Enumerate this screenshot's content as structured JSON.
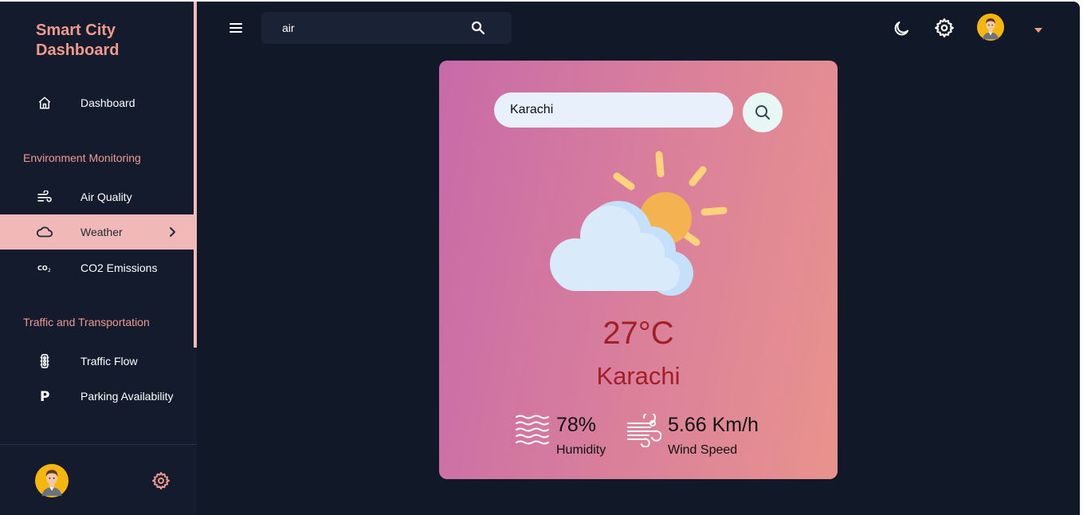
{
  "colors": {
    "accent": "#f09a8e",
    "active_item_bg": "#f0b8b6",
    "background": "#111827",
    "sidebar_bg": "#141b2d",
    "temperature_text": "#a21f27"
  },
  "sidebar": {
    "brand_line1": "Smart City",
    "brand_line2": "Dashboard",
    "dashboard": {
      "label": "Dashboard",
      "icon": "home-icon"
    },
    "section_env": "Environment Monitoring",
    "env_items": [
      {
        "label": "Air Quality",
        "icon": "wind-icon"
      },
      {
        "label": "Weather",
        "icon": "cloud-icon",
        "active": true
      },
      {
        "label": "CO2 Emissions",
        "icon": "co2-icon"
      }
    ],
    "section_traffic": "Traffic and Transportation",
    "traffic_items": [
      {
        "label": "Traffic Flow",
        "icon": "traffic-light-icon"
      },
      {
        "label": "Parking Availability",
        "icon": "parking-icon"
      }
    ]
  },
  "topbar": {
    "search_value": "air"
  },
  "weather": {
    "city_input_value": "Karachi",
    "temperature": "27°C",
    "city": "Karachi",
    "humidity_value": "78%",
    "humidity_label": "Humidity",
    "wind_value": "5.66 Km/h",
    "wind_label": "Wind Speed",
    "condition_icon": "partly-cloudy-icon"
  }
}
